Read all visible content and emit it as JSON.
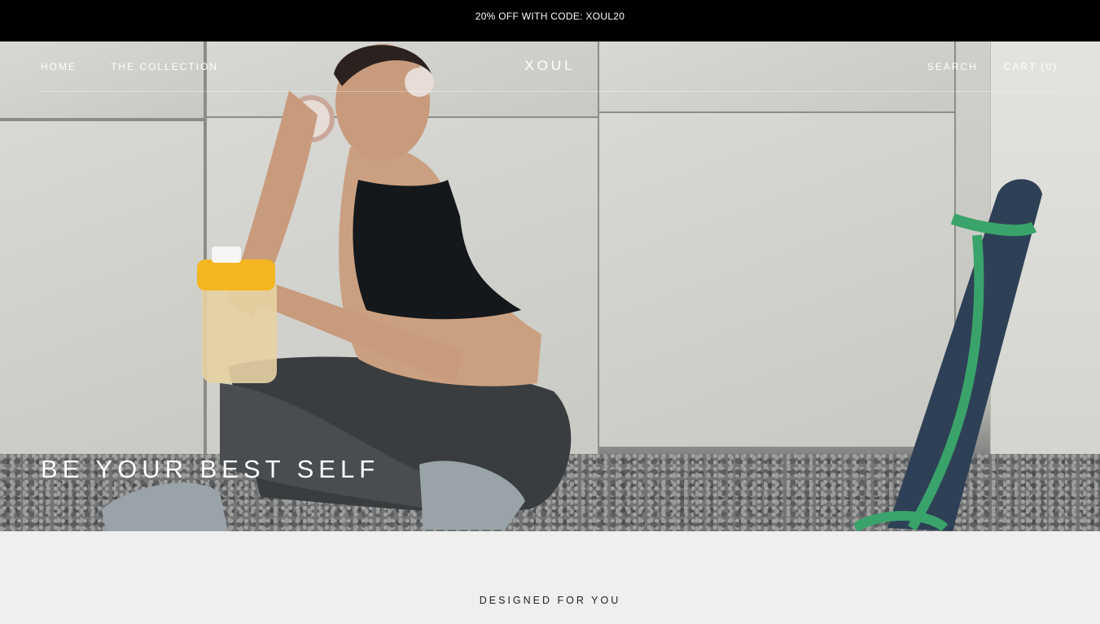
{
  "announcement": {
    "text": "20% OFF WITH CODE: XOUL20"
  },
  "nav": {
    "left_items": [
      "Home",
      "The Collection"
    ],
    "logo": "XOUL",
    "search_label": "SEARCH",
    "cart_label": "CART (0)"
  },
  "hero": {
    "heading": "BE YOUR BEST SELF",
    "image": "woman-with-headphones-and-yoga-mat"
  },
  "section": {
    "heading": "DESIGNED FOR YOU"
  },
  "colors": {
    "announce_bg": "#000000",
    "page_bg": "#efefef",
    "mat_strap": "#3aa36b"
  }
}
